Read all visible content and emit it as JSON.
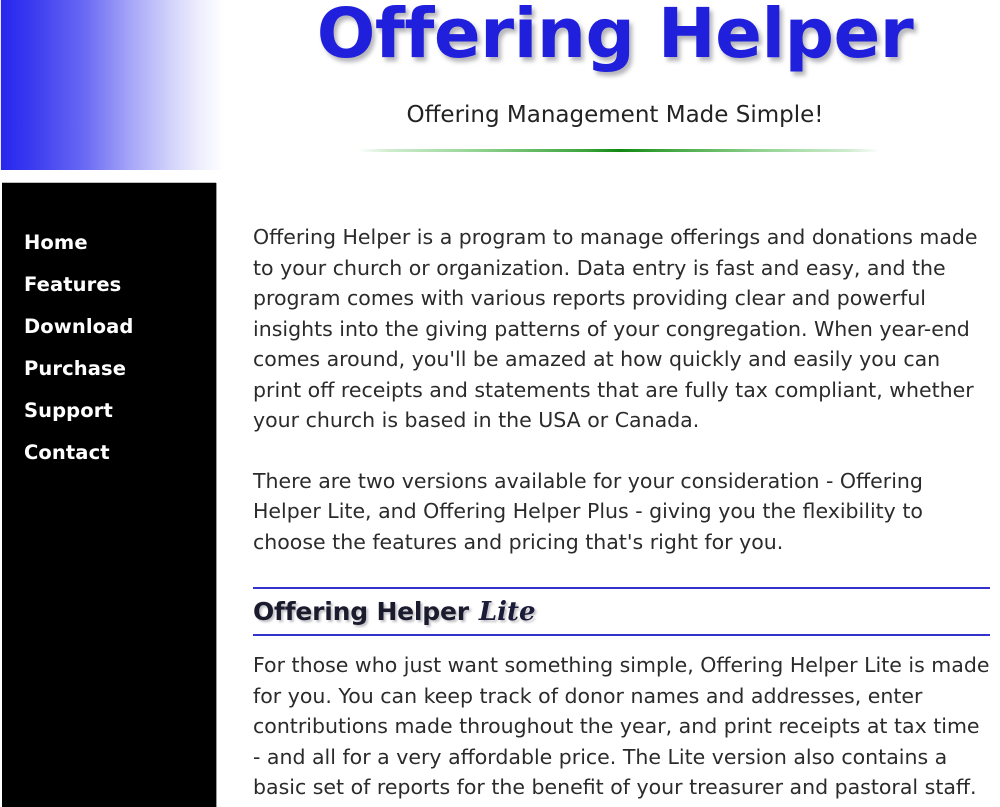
{
  "header": {
    "title": "Offering Helper",
    "tagline": "Offering Management Made Simple!",
    "title_color": "#1f1fdc",
    "rule_color": "#118811"
  },
  "sidebar": {
    "background_color": "#000000",
    "text_color": "#ffffff",
    "items": [
      {
        "label": "Home"
      },
      {
        "label": "Features"
      },
      {
        "label": "Download"
      },
      {
        "label": "Purchase"
      },
      {
        "label": "Support"
      },
      {
        "label": "Contact"
      }
    ]
  },
  "logo_block": {
    "gradient_from": "#2626ee",
    "gradient_to": "#ffffff"
  },
  "main": {
    "paragraphs": [
      "Offering Helper is a program to manage offerings and donations made to your church or organization. Data entry is fast and easy, and the program comes with various reports providing clear and powerful insights into the giving patterns of your congregation. When year-end comes around, you'll be amazed at how quickly and easily you can print off receipts and statements that are fully tax compliant, whether your church is based in the USA or Canada.",
      "There are two versions available for your consideration - Offering Helper Lite, and Offering Helper Plus - giving you the flexibility to choose the features and pricing that's right for you."
    ],
    "section": {
      "heading_main": "Offering Helper",
      "heading_variant": "Lite",
      "heading_rule_color": "#3333cc",
      "body": "For those who just want something simple, Offering Helper Lite is made for you.  You can keep track of donor names and addresses, enter contributions made throughout the year, and print receipts at tax time - and all for a very affordable price. The Lite version also contains a basic set of reports for the benefit of your treasurer and pastoral staff."
    }
  }
}
